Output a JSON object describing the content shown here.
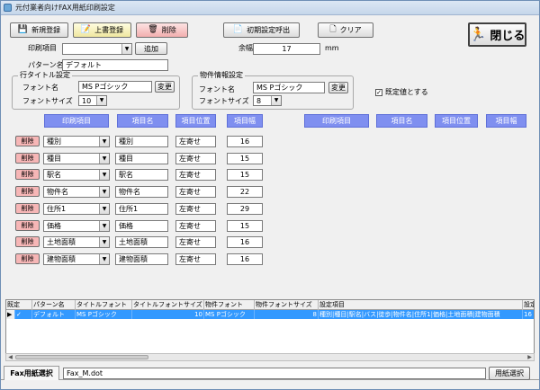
{
  "window": {
    "title": "元付業者向けFAX用紙印刷設定"
  },
  "toolbar": {
    "new_label": "新規登録",
    "overwrite_label": "上書登録",
    "delete_label": "削除",
    "load_default_label": "初期設定呼出",
    "clear_label": "クリア",
    "close_label": "閉じる"
  },
  "print_item": {
    "label": "印刷項目",
    "value": "",
    "add_label": "追加"
  },
  "margin": {
    "label": "余幅",
    "value": "17",
    "unit": "mm"
  },
  "pattern": {
    "label": "パターン名",
    "value": "デフォルト"
  },
  "row_title": {
    "group_label": "行タイトル設定",
    "font_label": "フォント名",
    "font_value": "MS Pゴシック",
    "change_label": "変更",
    "size_label": "フォントサイズ",
    "size_value": "10"
  },
  "property_info": {
    "group_label": "物件情報設定",
    "font_label": "フォント名",
    "font_value": "MS Pゴシック",
    "change_label": "変更",
    "size_label": "フォントサイズ",
    "size_value": "8"
  },
  "default_checkbox": {
    "label": "既定値とする",
    "checked": true,
    "mark": "✓"
  },
  "columns_left": [
    "印刷項目",
    "項目名",
    "項目位置",
    "項目幅"
  ],
  "columns_right": [
    "印刷項目",
    "項目名",
    "項目位置",
    "項目幅"
  ],
  "rows": [
    {
      "delete": "削除",
      "item": "種別",
      "name": "種別",
      "position": "左寄せ",
      "width": "16"
    },
    {
      "delete": "削除",
      "item": "種目",
      "name": "種目",
      "position": "左寄せ",
      "width": "15"
    },
    {
      "delete": "削除",
      "item": "駅名",
      "name": "駅名",
      "position": "左寄せ",
      "width": "15"
    },
    {
      "delete": "削除",
      "item": "物件名",
      "name": "物件名",
      "position": "左寄せ",
      "width": "22"
    },
    {
      "delete": "削除",
      "item": "住所1",
      "name": "住所1",
      "position": "左寄せ",
      "width": "29"
    },
    {
      "delete": "削除",
      "item": "価格",
      "name": "価格",
      "position": "左寄せ",
      "width": "15"
    },
    {
      "delete": "削除",
      "item": "土地面積",
      "name": "土地面積",
      "position": "左寄せ",
      "width": "16"
    },
    {
      "delete": "削除",
      "item": "建物面積",
      "name": "建物面積",
      "position": "左寄せ",
      "width": "16"
    }
  ],
  "grid": {
    "headers": [
      "既定",
      "パターン名",
      "タイトルフォント",
      "タイトルフォントサイズ",
      "物件フォント",
      "物件フォントサイズ",
      "設定項目",
      "設定"
    ],
    "row": {
      "indicator": "▶",
      "checked_mark": "✓",
      "pattern": "デフォルト",
      "title_font": "MS Pゴシック",
      "title_font_size": "10",
      "property_font": "MS Pゴシック",
      "property_font_size": "8",
      "items": "種別|種目|駅名|バス|徒歩|物件名|住所1|価格|土地面積|建物面積",
      "tail": "16"
    }
  },
  "bottom": {
    "tab_label": "Fax用紙選択",
    "file_value": "Fax_M.dot",
    "select_label": "用紙選択"
  },
  "colors": {
    "header_bg": "#7f8ff0",
    "selected_row": "#3399ff",
    "delete_btn_bg": "#f6b6b6"
  }
}
